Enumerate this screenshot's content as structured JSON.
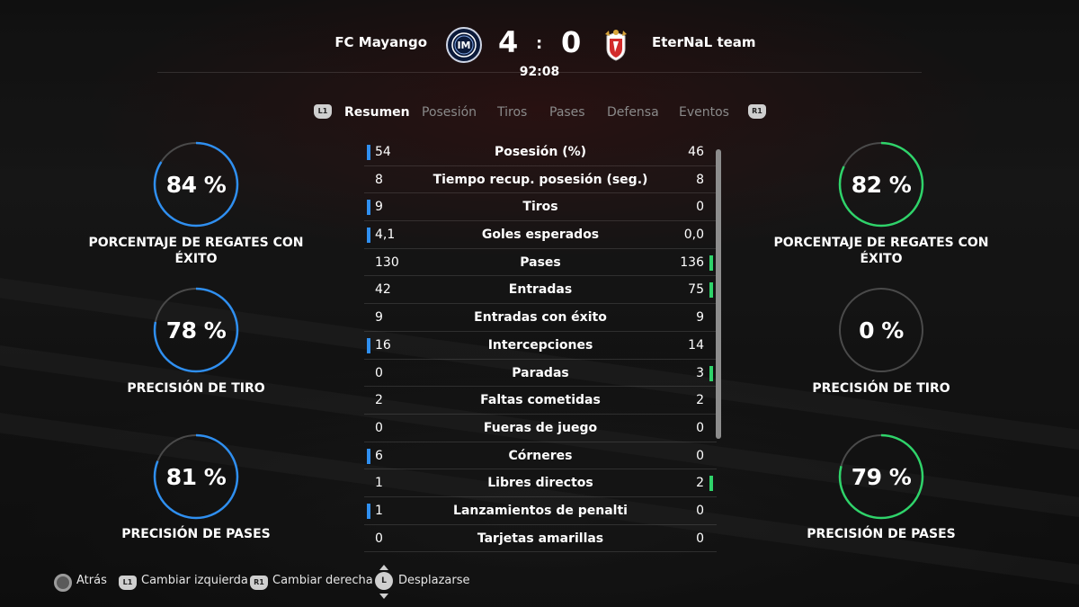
{
  "header": {
    "team_left": "FC Mayango",
    "team_right": "EterNaL team",
    "score_left": "4",
    "score_separator": ":",
    "score_right": "0",
    "clock": "92:08",
    "crest_left_text": "IM"
  },
  "tabs": {
    "left_button": "L1",
    "right_button": "R1",
    "items": [
      {
        "label": "Resumen",
        "active": true
      },
      {
        "label": "Posesión",
        "active": false
      },
      {
        "label": "Tiros",
        "active": false
      },
      {
        "label": "Pases",
        "active": false
      },
      {
        "label": "Defensa",
        "active": false
      },
      {
        "label": "Eventos",
        "active": false
      }
    ]
  },
  "left_gauges": [
    {
      "value_text": "84 %",
      "value": 84,
      "label": "PORCENTAJE DE REGATES CON ÉXITO"
    },
    {
      "value_text": "78 %",
      "value": 78,
      "label": "PRECISIÓN DE TIRO"
    },
    {
      "value_text": "81 %",
      "value": 81,
      "label": "PRECISIÓN DE PASES"
    }
  ],
  "right_gauges": [
    {
      "value_text": "82 %",
      "value": 82,
      "label": "PORCENTAJE DE REGATES CON ÉXITO"
    },
    {
      "value_text": "0 %",
      "value": 0,
      "label": "PRECISIÓN DE TIRO"
    },
    {
      "value_text": "79 %",
      "value": 79,
      "label": "PRECISIÓN DE PASES"
    }
  ],
  "stats": [
    {
      "left": "54",
      "label": "Posesión (%)",
      "right": "46",
      "leader": "left"
    },
    {
      "left": "8",
      "label": "Tiempo recup. posesión (seg.)",
      "right": "8",
      "leader": "none"
    },
    {
      "left": "9",
      "label": "Tiros",
      "right": "0",
      "leader": "left"
    },
    {
      "left": "4,1",
      "label": "Goles esperados",
      "right": "0,0",
      "leader": "left"
    },
    {
      "left": "130",
      "label": "Pases",
      "right": "136",
      "leader": "right"
    },
    {
      "left": "42",
      "label": "Entradas",
      "right": "75",
      "leader": "right"
    },
    {
      "left": "9",
      "label": "Entradas con éxito",
      "right": "9",
      "leader": "none"
    },
    {
      "left": "16",
      "label": "Intercepciones",
      "right": "14",
      "leader": "left"
    },
    {
      "left": "0",
      "label": "Paradas",
      "right": "3",
      "leader": "right"
    },
    {
      "left": "2",
      "label": "Faltas cometidas",
      "right": "2",
      "leader": "none"
    },
    {
      "left": "0",
      "label": "Fueras de juego",
      "right": "0",
      "leader": "none"
    },
    {
      "left": "6",
      "label": "Córneres",
      "right": "0",
      "leader": "left"
    },
    {
      "left": "1",
      "label": "Libres directos",
      "right": "2",
      "leader": "right"
    },
    {
      "left": "1",
      "label": "Lanzamientos de penalti",
      "right": "0",
      "leader": "left"
    },
    {
      "left": "0",
      "label": "Tarjetas amarillas",
      "right": "0",
      "leader": "none"
    }
  ],
  "footer": {
    "back": "Atrás",
    "l1_badge": "L1",
    "switch_left": "Cambiar izquierda",
    "r1_badge": "R1",
    "switch_right": "Cambiar derecha",
    "l_badge": "L",
    "scroll": "Desplazarse"
  },
  "colors": {
    "left_team": "#2f8ff0",
    "right_team": "#2fd36a",
    "ring_track": "#4a4a4a"
  }
}
